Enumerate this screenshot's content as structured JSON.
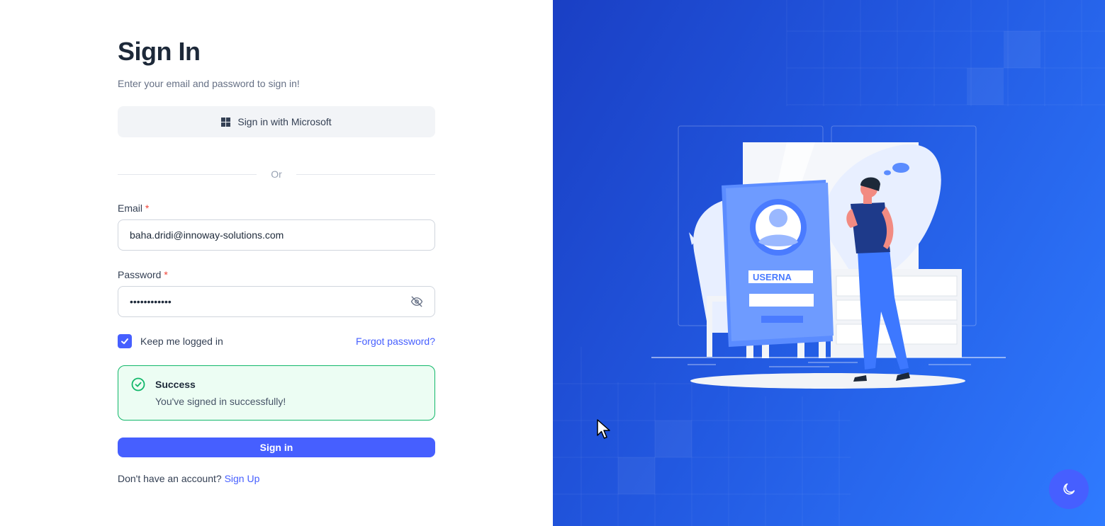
{
  "signin": {
    "title": "Sign In",
    "subtitle": "Enter your email and password to sign in!",
    "microsoft_button": "Sign in with Microsoft",
    "divider": "Or",
    "email_label": "Email",
    "required_mark": "*",
    "email_value": "baha.dridi@innoway-solutions.com",
    "password_label": "Password",
    "password_masked": "••••••••••••",
    "keep_logged_in": "Keep me logged in",
    "keep_checked": true,
    "forgot_password": "Forgot password?",
    "alert": {
      "title": "Success",
      "message": "You've signed in successfully!"
    },
    "submit_button": "Sign in",
    "no_account": "Don't have an account?",
    "signup_link": "Sign Up"
  },
  "illustration": {
    "badge_text": "USERNA"
  },
  "icons": {
    "microsoft": "microsoft-icon",
    "eye_off": "eye-off-icon",
    "check": "check-icon",
    "success": "check-circle-icon",
    "theme": "moon-icon",
    "cursor": "mouse-cursor-icon"
  },
  "colors": {
    "accent": "#465fff",
    "success_border": "#12b76a",
    "success_bg": "#ecfdf3",
    "required": "#f04438",
    "panel_gradient_start": "#1a3fc4",
    "panel_gradient_end": "#2f7bff"
  }
}
